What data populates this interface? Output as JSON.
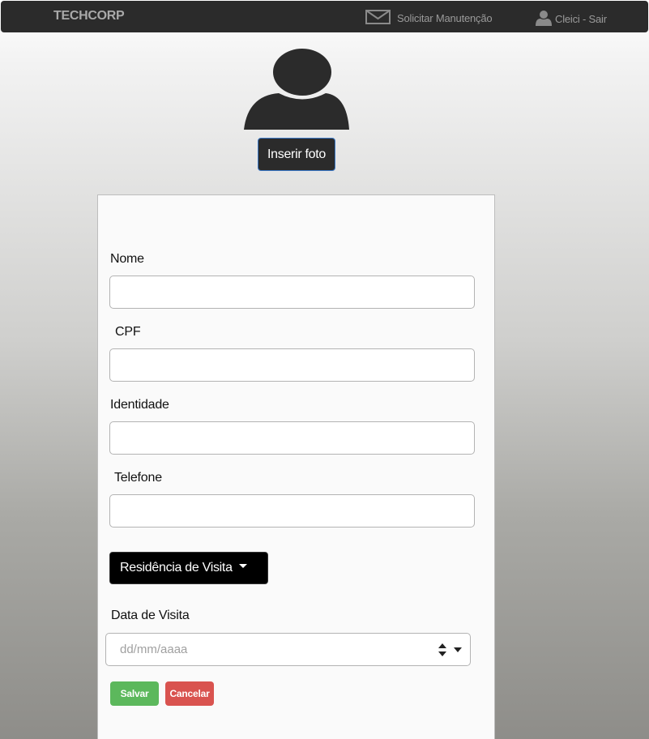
{
  "navbar": {
    "brand": "TECHCORP",
    "maintenance_label": "Solicitar Manutenção",
    "maintenance_icon": "envelope-icon",
    "user_label": "Cleici - Sair",
    "user_icon": "user-icon"
  },
  "profile": {
    "avatar_icon": "user-silhouette-icon",
    "photo_button_label": "Inserir foto"
  },
  "form": {
    "name_label": "Nome",
    "name_value": "",
    "cpf_label": "CPF",
    "cpf_value": "",
    "identity_label": "Identidade",
    "identity_value": "",
    "phone_label": "Telefone",
    "phone_value": "",
    "residence_dropdown_label": "Residência de Visita",
    "visit_date_label": "Data de Visita",
    "visit_date_placeholder": "dd/mm/aaaa",
    "save_label": "Salvar",
    "cancel_label": "Cancelar"
  },
  "colors": {
    "navbar_bg": "#2b2b2b",
    "save_green": "#5cb85c",
    "cancel_red": "#d9534f"
  }
}
